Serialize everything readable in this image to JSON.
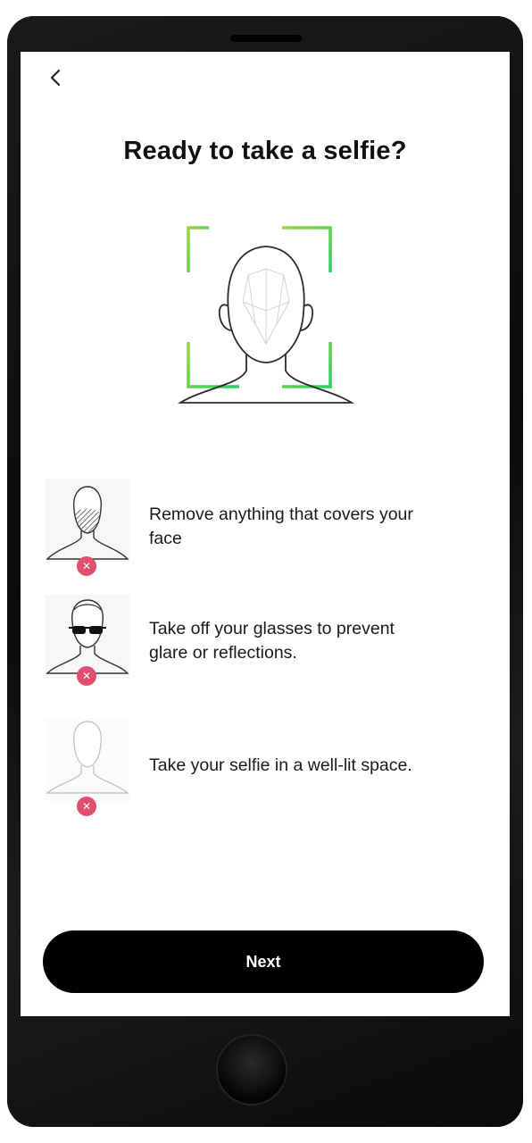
{
  "screen": {
    "title": "Ready to take a selfie?",
    "back_icon": "chevron-left-icon",
    "accent_color": "#4cd44c",
    "error_color": "#e0506d"
  },
  "tips": [
    {
      "icon": "face-covered-icon",
      "status_icon": "x-circle-icon",
      "line1": "Remove anything that covers your",
      "line2": "face"
    },
    {
      "icon": "sunglasses-face-icon",
      "status_icon": "x-circle-icon",
      "line1": "Take off your glasses to prevent",
      "line2": "glare or reflections."
    },
    {
      "icon": "dim-light-face-icon",
      "status_icon": "x-circle-icon",
      "line1": "Take your selfie in a well-lit space.",
      "line2": ""
    }
  ],
  "next_button": {
    "label": "Next"
  }
}
